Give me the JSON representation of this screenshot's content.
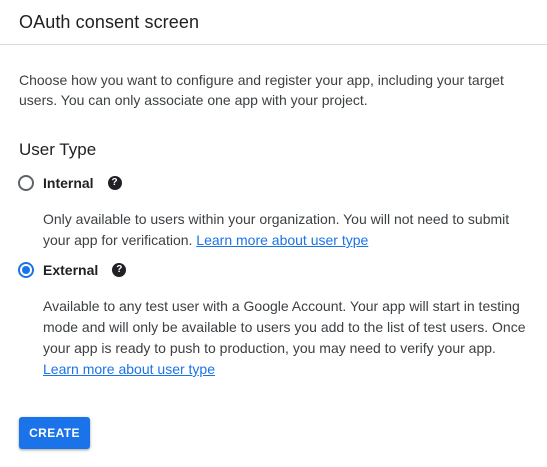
{
  "header": {
    "title": "OAuth consent screen"
  },
  "intro": {
    "text": "Choose how you want to configure and register your app, including your target users. You can only associate one app with your project."
  },
  "user_type": {
    "heading": "User Type",
    "options": [
      {
        "label": "Internal",
        "selected": false,
        "help_icon": "question-circle-icon",
        "description": "Only available to users within your organization. You will not need to submit your app for verification.",
        "link": "Learn more about user type"
      },
      {
        "label": "External",
        "selected": true,
        "help_icon": "question-circle-icon",
        "description": "Available to any test user with a Google Account. Your app will start in testing mode and will only be available to users you add to the list of test users. Once your app is ready to push to production, you may need to verify your app.",
        "link": "Learn more about user type"
      }
    ]
  },
  "actions": {
    "create_label": "CREATE"
  },
  "colors": {
    "accent": "#1a73e8",
    "text": "#202124",
    "secondary_text": "#3c4043",
    "divider": "#dadce0"
  }
}
